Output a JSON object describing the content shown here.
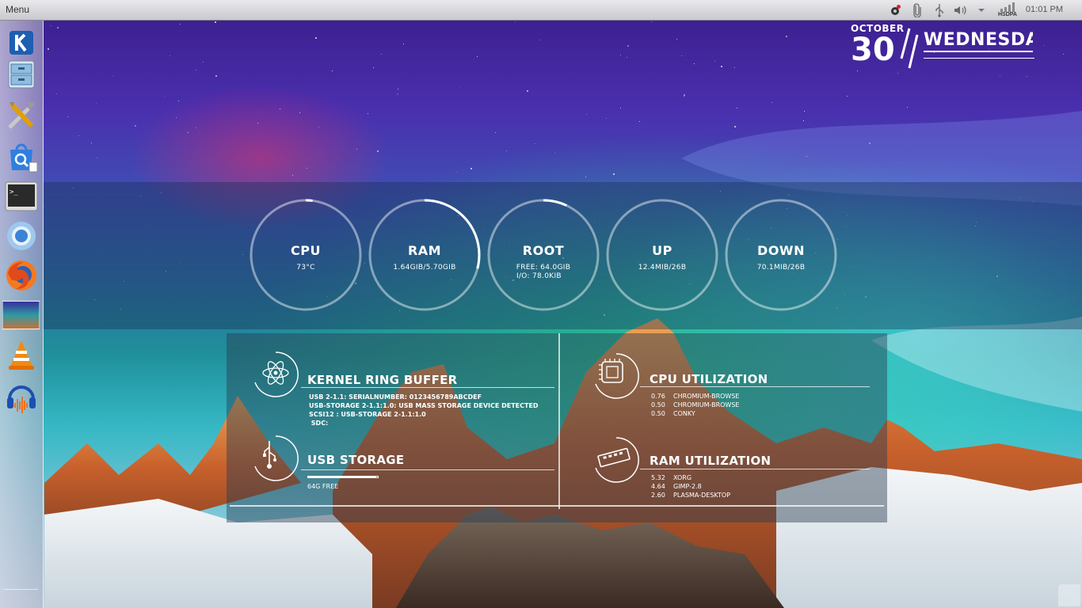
{
  "top_panel": {
    "menu_label": "Menu",
    "network_label": "HSDPA",
    "clock": "01:01 PM",
    "tray_icons": [
      "update-gear-icon",
      "attachment-icon",
      "usb-icon",
      "volume-icon",
      "chevron-down-icon",
      "signal-icon"
    ]
  },
  "dock": {
    "items": [
      "kde-launcher-icon",
      "file-cabinet-icon",
      "tools-icon",
      "software-center-icon",
      "terminal-icon",
      "chromium-icon",
      "firefox-icon",
      "wallpaper-thumbnail-icon",
      "vlc-icon",
      "audacity-icon"
    ]
  },
  "date_widget": {
    "month": "OCTOBER",
    "day": "30",
    "weekday": "WEDNESDA"
  },
  "gauges": [
    {
      "title": "CPU",
      "value_lines": [
        "73°C"
      ],
      "fraction": 0.02
    },
    {
      "title": "RAM",
      "value_lines": [
        "1.64GIB/5.70GIB"
      ],
      "fraction": 0.29
    },
    {
      "title": "ROOT",
      "value_lines": [
        "FREE: 64.0GIB",
        "I/O: 78.0KIB"
      ],
      "fraction": 0.07
    },
    {
      "title": "UP",
      "value_lines": [
        "12.4MIB/26B"
      ],
      "fraction": 0.0
    },
    {
      "title": "DOWN",
      "value_lines": [
        "70.1MIB/26B"
      ],
      "fraction": 0.0
    }
  ],
  "kernel_ring_buffer": {
    "title": "KERNEL RING BUFFER",
    "lines": [
      "USB 2-1.1: SERIALNUMBER: 0123456789ABCDEF",
      "USB-STORAGE 2-1.1:1.0: USB MASS STORAGE DEVICE DETECTED",
      "SCSI12 : USB-STORAGE 2-1.1:1.0",
      " SDC:"
    ]
  },
  "usb_storage": {
    "title": "USB STORAGE",
    "free_label": "64G FREE",
    "used_fraction": 0.98
  },
  "cpu_utilization": {
    "title": "CPU UTILIZATION",
    "processes": [
      {
        "value": "0.76",
        "name": "CHROMIUM-BROWSE"
      },
      {
        "value": "0.50",
        "name": "CHROMIUM-BROWSE"
      },
      {
        "value": "0.50",
        "name": "CONKY"
      }
    ]
  },
  "ram_utilization": {
    "title": "RAM UTILIZATION",
    "processes": [
      {
        "value": "5.32",
        "name": "XORG"
      },
      {
        "value": "4.64",
        "name": "GIMP-2.8"
      },
      {
        "value": "2.60",
        "name": "PLASMA-DESKTOP"
      }
    ]
  },
  "colors": {
    "accent": "#ffffff",
    "panel_bg": "#c9c9ce",
    "sky_top": "#3a1d8a",
    "aurora": "#1fa38a"
  }
}
